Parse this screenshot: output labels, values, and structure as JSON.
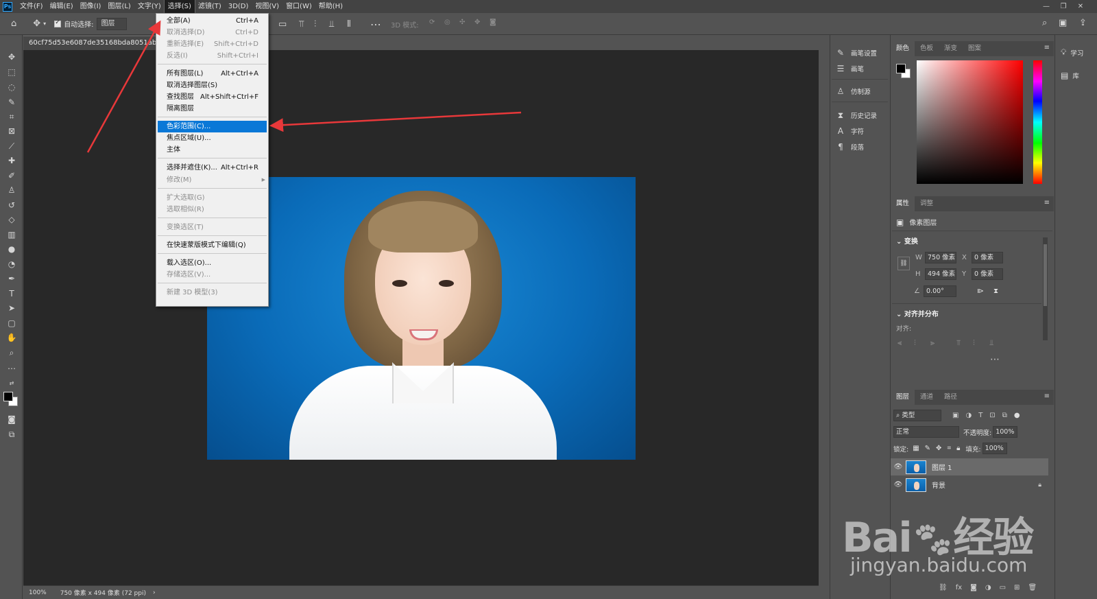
{
  "menubar": {
    "logo": "Ps",
    "items": [
      "文件(F)",
      "编辑(E)",
      "图像(I)",
      "图层(L)",
      "文字(Y)",
      "选择(S)",
      "滤镜(T)",
      "3D(D)",
      "视图(V)",
      "窗口(W)",
      "帮助(H)"
    ],
    "active_index": 5
  },
  "window_controls": [
    "—",
    "❐",
    "✕"
  ],
  "options_bar": {
    "auto_select_label": "自动选择:",
    "auto_select_checked": true,
    "target_value": "图层",
    "mode_3d_label": "3D 模式:"
  },
  "document": {
    "tab_title": "60cf75d53e6087de35168bda8051ab75.jpe",
    "zoom": "100%",
    "info": "750 像素 x 494 像素 (72 ppi)"
  },
  "select_menu": [
    {
      "label": "全部(A)",
      "shortcut": "Ctrl+A",
      "disabled": false
    },
    {
      "label": "取消选择(D)",
      "shortcut": "Ctrl+D",
      "disabled": true
    },
    {
      "label": "重新选择(E)",
      "shortcut": "Shift+Ctrl+D",
      "disabled": true
    },
    {
      "label": "反选(I)",
      "shortcut": "Shift+Ctrl+I",
      "disabled": true
    },
    {
      "label": "所有图层(L)",
      "shortcut": "Alt+Ctrl+A",
      "disabled": false
    },
    {
      "label": "取消选择图层(S)",
      "shortcut": "",
      "disabled": false
    },
    {
      "label": "查找图层",
      "shortcut": "Alt+Shift+Ctrl+F",
      "disabled": false
    },
    {
      "label": "隔离图层",
      "shortcut": "",
      "disabled": false
    },
    {
      "label": "色彩范围(C)...",
      "shortcut": "",
      "disabled": false,
      "highlight": true
    },
    {
      "label": "焦点区域(U)...",
      "shortcut": "",
      "disabled": false
    },
    {
      "label": "主体",
      "shortcut": "",
      "disabled": false
    },
    {
      "label": "选择并遮住(K)...",
      "shortcut": "Alt+Ctrl+R",
      "disabled": false
    },
    {
      "label": "修改(M)",
      "shortcut": "",
      "disabled": true,
      "submenu": true
    },
    {
      "label": "扩大选取(G)",
      "shortcut": "",
      "disabled": true
    },
    {
      "label": "选取相似(R)",
      "shortcut": "",
      "disabled": true
    },
    {
      "label": "变换选区(T)",
      "shortcut": "",
      "disabled": true
    },
    {
      "label": "在快速蒙版模式下编辑(Q)",
      "shortcut": "",
      "disabled": false
    },
    {
      "label": "载入选区(O)...",
      "shortcut": "",
      "disabled": false
    },
    {
      "label": "存储选区(V)...",
      "shortcut": "",
      "disabled": true
    },
    {
      "label": "新建 3D 模型(3)",
      "shortcut": "",
      "disabled": true
    }
  ],
  "mid_panel": [
    "画笔设置",
    "画笔",
    "仿制源",
    "历史记录",
    "字符",
    "段落"
  ],
  "color_panel": {
    "tabs": [
      "颜色",
      "色板",
      "渐变",
      "图案"
    ],
    "foreground": "#000000",
    "background": "#ffffff"
  },
  "properties_panel": {
    "tabs": [
      "属性",
      "调整"
    ],
    "layer_type": "像素图层",
    "transform_title": "变换",
    "w_label": "W",
    "w_value": "750 像素",
    "h_label": "H",
    "h_value": "494 像素",
    "x_label": "X",
    "x_value": "0 像素",
    "y_label": "Y",
    "y_value": "0 像素",
    "angle_value": "0.00°",
    "align_title": "对齐并分布",
    "align_label": "对齐:"
  },
  "layers_panel": {
    "tabs": [
      "图层",
      "通道",
      "路径"
    ],
    "filter_value": "类型",
    "blend_mode": "正常",
    "opacity_label": "不透明度:",
    "opacity_value": "100%",
    "lock_label": "锁定:",
    "fill_label": "填充:",
    "fill_value": "100%",
    "layers": [
      {
        "name": "图层 1",
        "selected": true,
        "locked": false
      },
      {
        "name": "背景",
        "selected": false,
        "locked": true
      }
    ]
  },
  "far_right": [
    "学习",
    "库"
  ],
  "watermark": {
    "brand": "Bai",
    "brand2": "经验",
    "url": "jingyan.baidu.com"
  }
}
